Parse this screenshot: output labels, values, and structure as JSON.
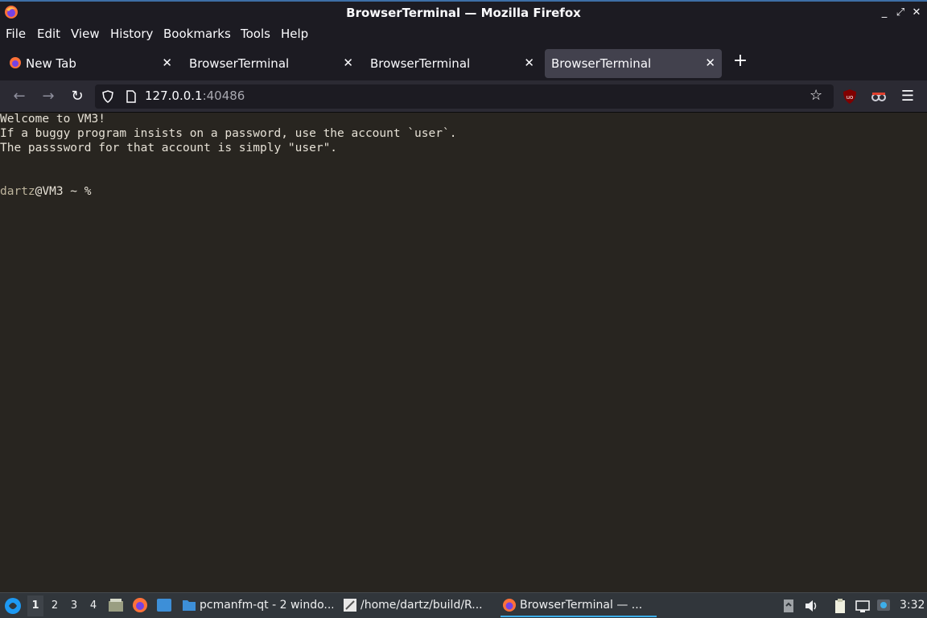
{
  "window": {
    "title": "BrowserTerminal — Mozilla Firefox"
  },
  "menu": [
    "File",
    "Edit",
    "View",
    "History",
    "Bookmarks",
    "Tools",
    "Help"
  ],
  "tabs": [
    {
      "label": "New Tab",
      "active": false
    },
    {
      "label": "BrowserTerminal",
      "active": false
    },
    {
      "label": "BrowserTerminal",
      "active": false
    },
    {
      "label": "BrowserTerminal",
      "active": true
    }
  ],
  "navbar": {
    "url_host": "127.0.0.1",
    "url_port": ":40486"
  },
  "terminal": {
    "lines": [
      "Welcome to VM3!",
      "If a buggy program insists on a password, use the account `user`.",
      "The passsword for that account is simply \"user\"."
    ],
    "prompt_user": "dartz",
    "prompt_rest": "@VM3 ~ %"
  },
  "taskbar": {
    "workspaces": [
      "1",
      "2",
      "3",
      "4"
    ],
    "tasks": [
      {
        "label": "pcmanfm-qt - 2 windo...",
        "icon": "folder-icon"
      },
      {
        "label": "/home/dartz/build/R...",
        "icon": "text-editor-icon"
      },
      {
        "label": "BrowserTerminal — ...",
        "icon": "firefox-icon"
      }
    ],
    "clock": "3:32"
  },
  "colors": {
    "accent": "#3daee9",
    "terminal_bg": "#282520",
    "tab_active": "#42414d"
  }
}
